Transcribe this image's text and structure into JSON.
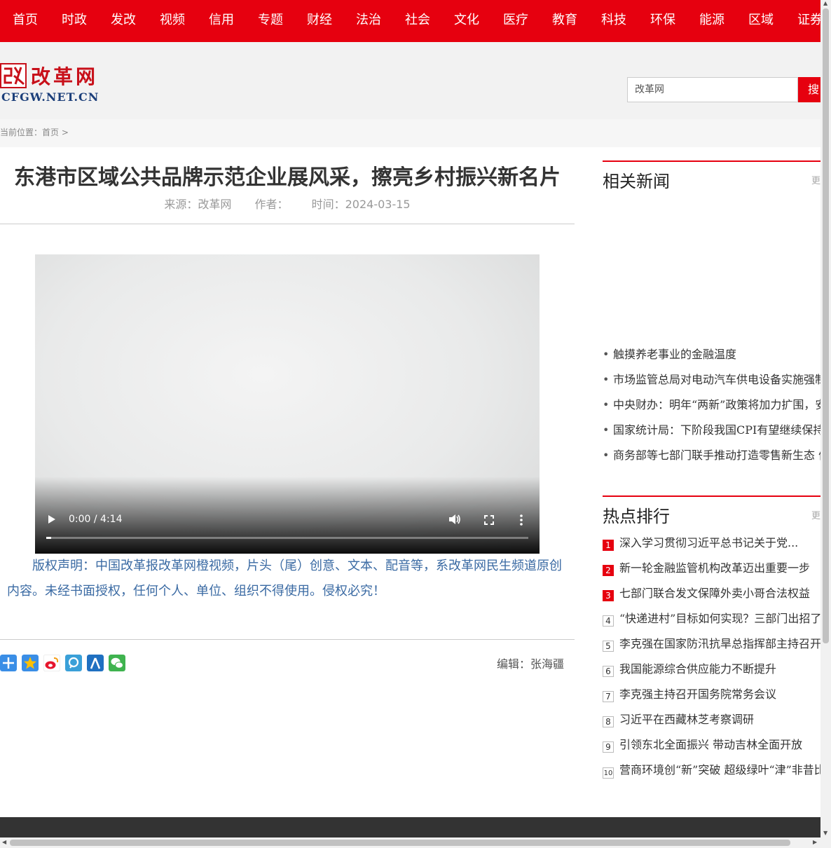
{
  "nav": {
    "items": [
      "首页",
      "时政",
      "发改",
      "视频",
      "信用",
      "专题",
      "财经",
      "法治",
      "社会",
      "文化",
      "医疗",
      "教育",
      "科技",
      "环保",
      "能源",
      "区域",
      "证券"
    ]
  },
  "header": {
    "logo_title": "改革网",
    "logo_sub": "CFGW.NET.CN",
    "search_value": "改革网",
    "search_button": "搜"
  },
  "breadcrumb": {
    "label": "当前位置：",
    "home": "首页",
    "sep": ">"
  },
  "article": {
    "title": "东港市区域公共品牌示范企业展风采，擦亮乡村振兴新名片",
    "source": "来源：改革网",
    "author": "作者：",
    "time": "时间：2024-03-15",
    "notice": "版权声明：中国改革报改革网橙视频，片头（尾）创意、文本、配音等，系改革网民生频道原创内容。未经书面授权，任何个人、单位、组织不得使用。侵权必究！",
    "editor": "编辑：张海疆"
  },
  "video": {
    "time": "0:00 / 4:14",
    "progress": 0.01
  },
  "share": {
    "icons": [
      "share-plus-icon",
      "qzone-icon",
      "weibo-icon",
      "tencent-weibo-icon",
      "renren-icon",
      "wechat-icon"
    ]
  },
  "sidebar": {
    "related": {
      "title": "相关新闻",
      "more": "更",
      "items": [
        "触摸养老事业的金融温度",
        "市场监管总局对电动汽车供电设备实施强制性产品认证",
        "中央财办：明年“两新”政策将加力扩围，安排上更加合理",
        "国家统计局：下阶段我国CPI有望继续保持温和回升态势",
        "商务部等七部门联手推动打造零售新生态 催生消费新活力"
      ]
    },
    "hot": {
      "title": "热点排行",
      "more": "更",
      "items": [
        {
          "rank": "1",
          "text": "深入学习贯彻习近平总书记关于党..."
        },
        {
          "rank": "2",
          "text": "新一轮金融监管机构改革迈出重要一步"
        },
        {
          "rank": "3",
          "text": "七部门联合发文保障外卖小哥合法权益"
        },
        {
          "rank": "4",
          "text": "“快递进村”目标如何实现？三部门出招了"
        },
        {
          "rank": "5",
          "text": "李克强在国家防汛抗旱总指挥部主持召开会议"
        },
        {
          "rank": "6",
          "text": "我国能源综合供应能力不断提升"
        },
        {
          "rank": "7",
          "text": "李克强主持召开国务院常务会议"
        },
        {
          "rank": "8",
          "text": "习近平在西藏林芝考察调研"
        },
        {
          "rank": "9",
          "text": "引领东北全面振兴 带动吉林全面开放"
        },
        {
          "rank": "10",
          "text": "营商环境创“新”突破 超级绿叶“津”非昔比"
        }
      ]
    }
  },
  "colors": {
    "brand_red": "#e6000f",
    "notice_blue": "#3a6aa3"
  }
}
